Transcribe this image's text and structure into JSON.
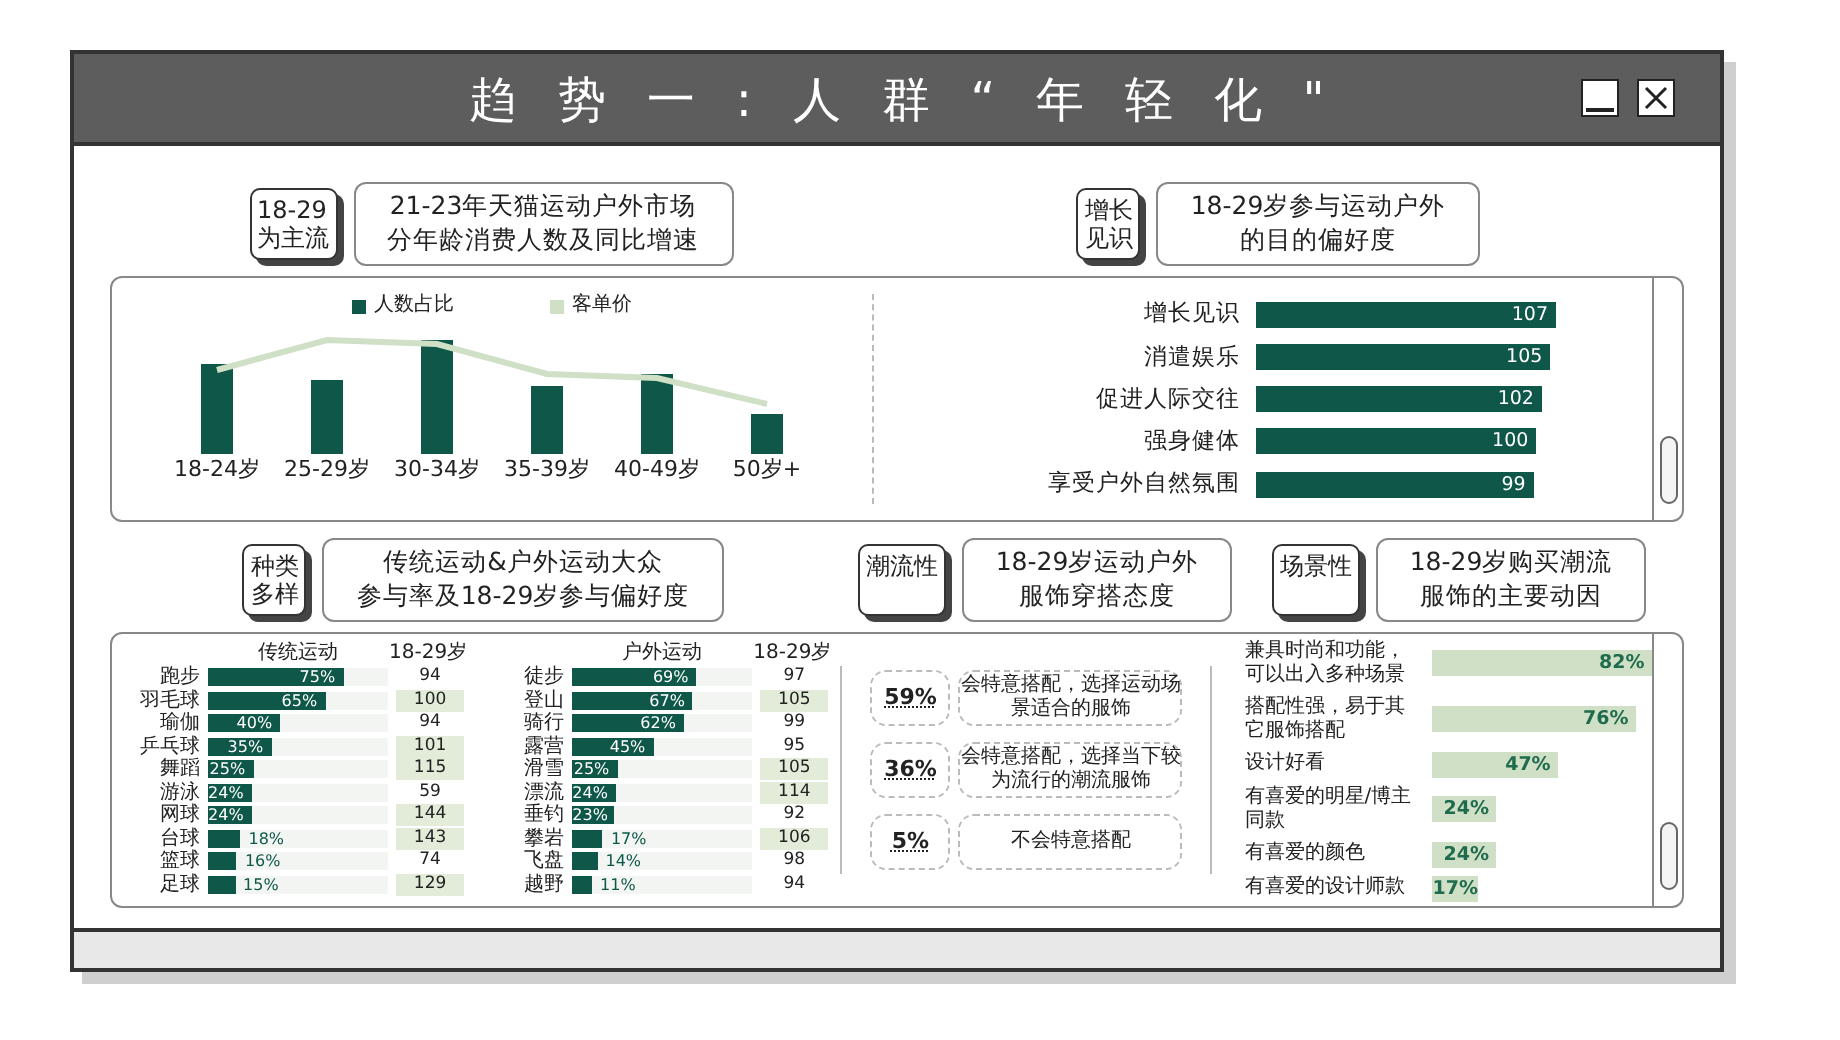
{
  "window": {
    "title": "趋势一:人群“年轻化\""
  },
  "top_headers": [
    {
      "tag": [
        "18-29",
        "为主流"
      ],
      "title": [
        "21-23年天猫运动户外市场",
        "分年龄消费人数及同比增速"
      ]
    },
    {
      "tag": [
        "增长",
        "见识"
      ],
      "title": [
        "18-29岁参与运动户外",
        "的目的偏好度"
      ]
    }
  ],
  "age_chart": {
    "legend": [
      {
        "label": "人数占比",
        "kind": "bar"
      },
      {
        "label": "客单价",
        "kind": "line"
      }
    ],
    "categories": [
      "18-24岁",
      "25-29岁",
      "30-34岁",
      "35-39岁",
      "40-49岁",
      "50岁+"
    ]
  },
  "purpose_chart": {
    "chart_data": {
      "type": "bar",
      "orientation": "horizontal",
      "categories": [
        "增长见识",
        "消遣娱乐",
        "促进人际交往",
        "强身健体",
        "享受户外自然氛围"
      ],
      "values": [
        107,
        105,
        102,
        100,
        99
      ],
      "data_labels": true
    }
  },
  "bottom_headers": [
    {
      "tag": [
        "种类",
        "多样"
      ],
      "title": [
        "传统运动&户外运动大众",
        "参与率及18-29岁参与偏好度"
      ]
    },
    {
      "tag": [
        "潮流性"
      ],
      "title": [
        "18-29岁运动户外",
        "服饰穿搭态度"
      ]
    },
    {
      "tag": [
        "场景性"
      ],
      "title": [
        "18-29岁购买潮流",
        "服饰的主要动因"
      ]
    }
  ],
  "sport_tables": [
    {
      "heading": "传统运动",
      "index_heading": "18-29岁",
      "rows": [
        {
          "name": "跑步",
          "share": "75%",
          "level": 0.75,
          "index": "94",
          "highlight": false
        },
        {
          "name": "羽毛球",
          "share": "65%",
          "level": 0.65,
          "index": "100",
          "highlight": true
        },
        {
          "name": "瑜伽",
          "share": "40%",
          "level": 0.4,
          "index": "94",
          "highlight": false
        },
        {
          "name": "乒乓球",
          "share": "35%",
          "level": 0.35,
          "index": "101",
          "highlight": true
        },
        {
          "name": "舞蹈",
          "share": "25%",
          "level": 0.25,
          "index": "115",
          "highlight": true
        },
        {
          "name": "游泳",
          "share": "24%",
          "level": 0.24,
          "index": "59",
          "highlight": false
        },
        {
          "name": "网球",
          "share": "24%",
          "level": 0.24,
          "index": "144",
          "highlight": true
        },
        {
          "name": "台球",
          "share": "18%",
          "level": 0.18,
          "index": "143",
          "highlight": true
        },
        {
          "name": "篮球",
          "share": "16%",
          "level": 0.16,
          "index": "74",
          "highlight": false
        },
        {
          "name": "足球",
          "share": "15%",
          "level": 0.15,
          "index": "129",
          "highlight": true
        }
      ]
    },
    {
      "heading": "户外运动",
      "index_heading": "18-29岁",
      "rows": [
        {
          "name": "徒步",
          "share": "69%",
          "level": 0.69,
          "index": "97",
          "highlight": false
        },
        {
          "name": "登山",
          "share": "67%",
          "level": 0.67,
          "index": "105",
          "highlight": true
        },
        {
          "name": "骑行",
          "share": "62%",
          "level": 0.62,
          "index": "99",
          "highlight": false
        },
        {
          "name": "露营",
          "share": "45%",
          "level": 0.45,
          "index": "95",
          "highlight": false
        },
        {
          "name": "滑雪",
          "share": "25%",
          "level": 0.25,
          "index": "105",
          "highlight": true
        },
        {
          "name": "漂流",
          "share": "24%",
          "level": 0.24,
          "index": "114",
          "highlight": true
        },
        {
          "name": "垂钓",
          "share": "23%",
          "level": 0.23,
          "index": "92",
          "highlight": false
        },
        {
          "name": "攀岩",
          "share": "17%",
          "level": 0.17,
          "index": "106",
          "highlight": true
        },
        {
          "name": "飞盘",
          "share": "14%",
          "level": 0.14,
          "index": "98",
          "highlight": false
        },
        {
          "name": "越野",
          "share": "11%",
          "level": 0.11,
          "index": "94",
          "highlight": false
        }
      ]
    }
  ],
  "attitudes": [
    {
      "share": "59%",
      "text": "会特意搭配，选择运动场景适合的服饰"
    },
    {
      "share": "36%",
      "text": "会特意搭配，选择当下较为流行的潮流服饰"
    },
    {
      "share": "5%",
      "text": "不会特意搭配"
    }
  ],
  "motive_chart": {
    "chart_data": {
      "type": "bar",
      "orientation": "horizontal",
      "categories": [
        "兼具时尚和功能，可以出入多种场景",
        "搭配性强，易于其它服饰搭配",
        "设计好看",
        "有喜爱的明星/博主同款",
        "有喜爱的颜色",
        "有喜爱的设计师款"
      ],
      "values": [
        82,
        76,
        47,
        24,
        24,
        17
      ],
      "value_labels": [
        "82%",
        "76%",
        "47%",
        "24%",
        "24%",
        "17%"
      ]
    }
  }
}
